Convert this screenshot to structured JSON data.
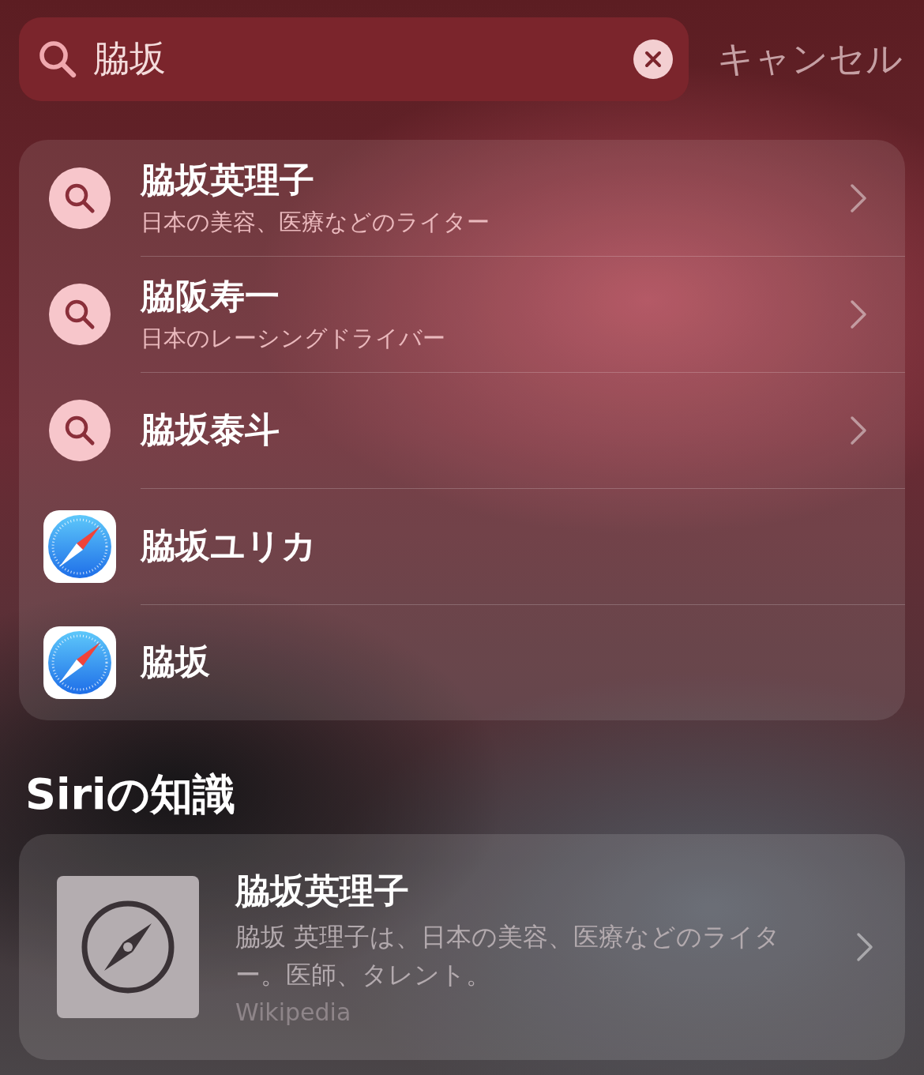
{
  "search": {
    "value": "脇坂",
    "cancel": "キャンセル"
  },
  "results": [
    {
      "kind": "search",
      "title": "脇坂英理子",
      "subtitle": "日本の美容、医療などのライター"
    },
    {
      "kind": "search",
      "title": "脇阪寿一",
      "subtitle": "日本のレーシングドライバー"
    },
    {
      "kind": "search",
      "title": "脇坂泰斗"
    },
    {
      "kind": "web",
      "title": "脇坂ユリカ"
    },
    {
      "kind": "web",
      "title": "脇坂"
    }
  ],
  "knowledge": {
    "heading": "Siriの知識",
    "title": "脇坂英理子",
    "description": "脇坂 英理子は、日本の美容、医療などのライター。医師、タレント。",
    "source": "Wikipedia"
  }
}
